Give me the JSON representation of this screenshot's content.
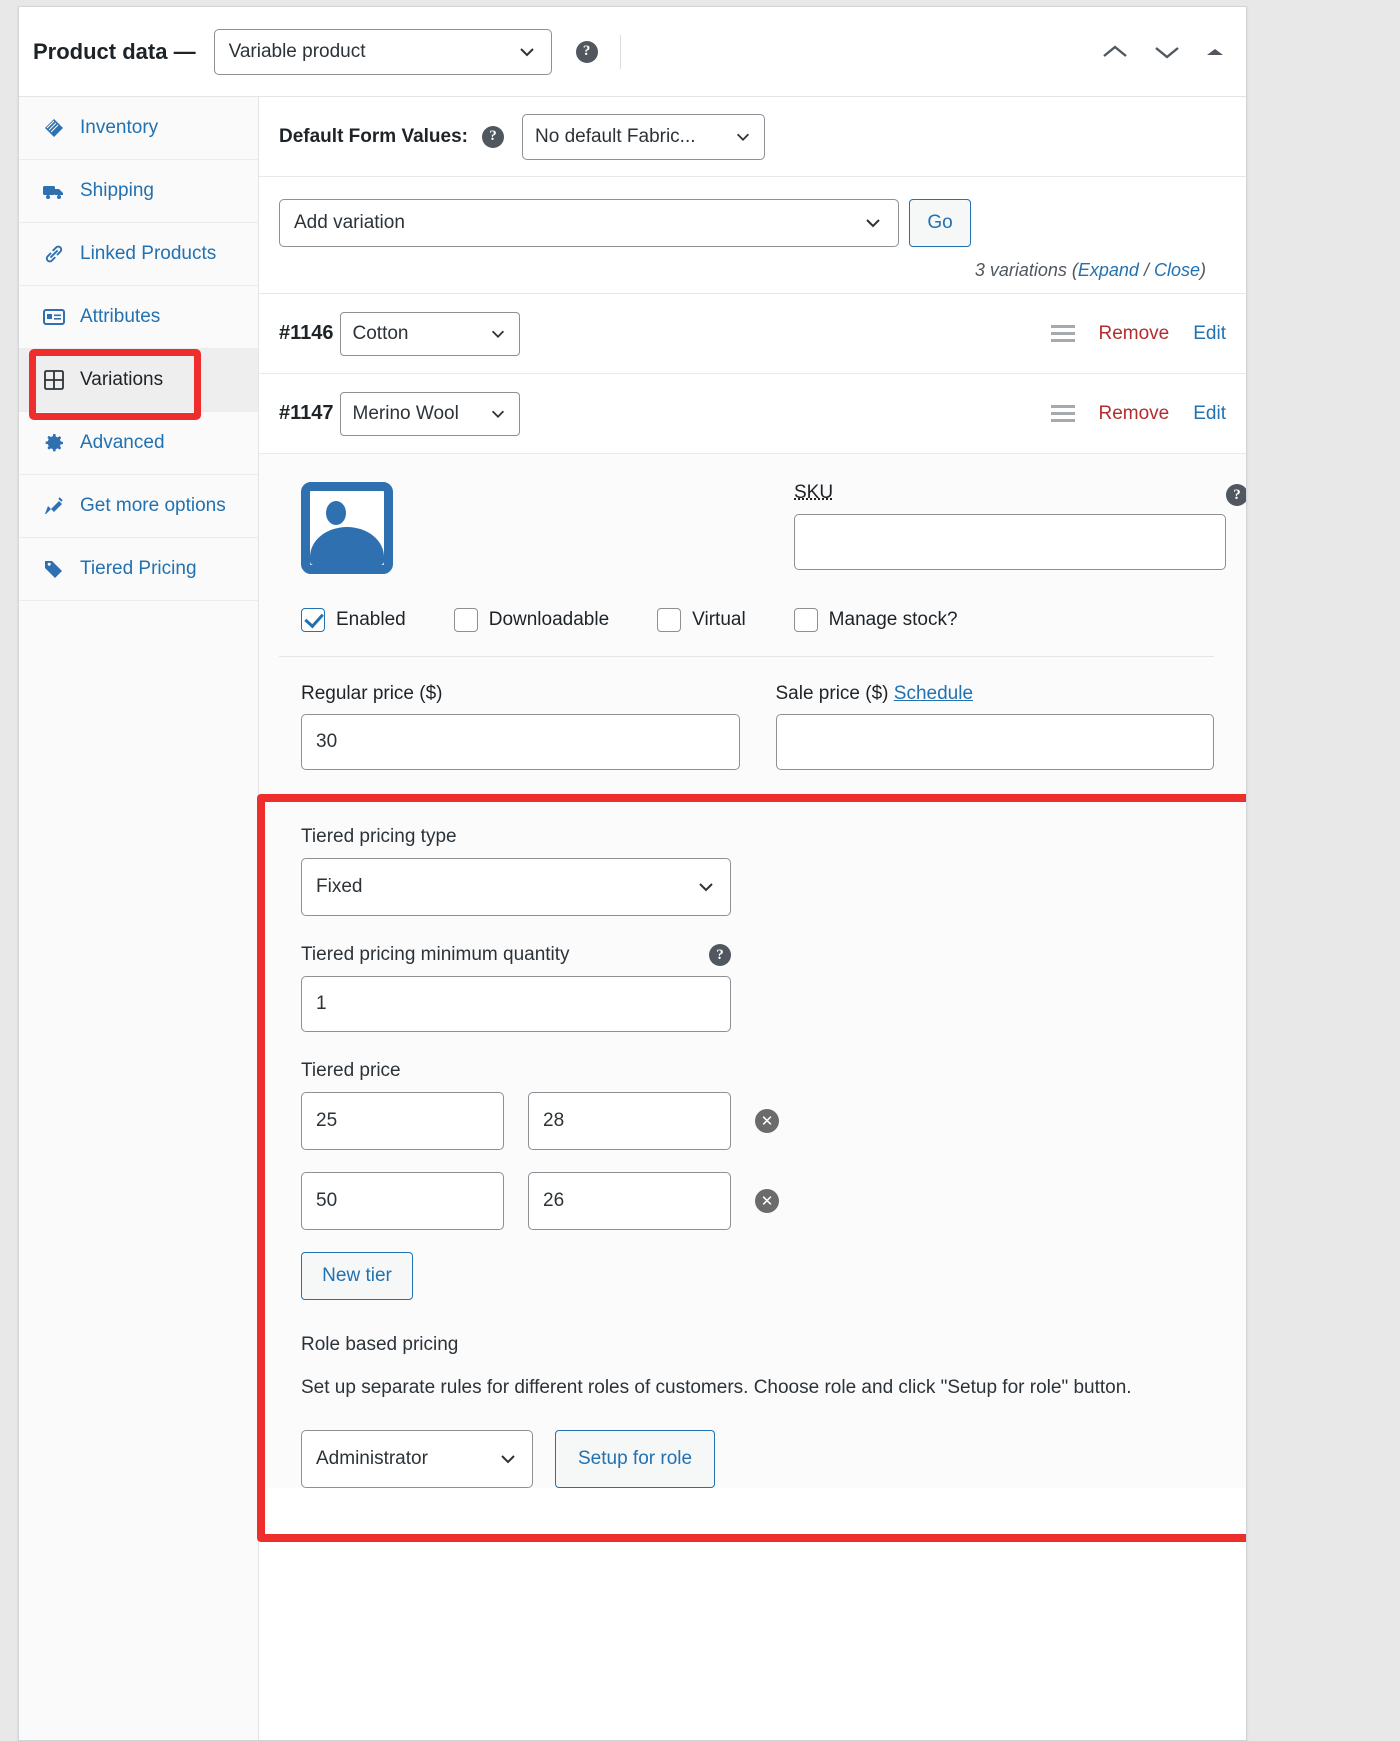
{
  "header": {
    "title": "Product data —",
    "product_type": "Variable product",
    "help_icon": "help-circle-icon",
    "collapse_up_icon": "chevron-up-icon",
    "collapse_down_icon": "chevron-down-icon",
    "toggle_icon": "caret-up-icon"
  },
  "sidebar": {
    "items": [
      {
        "label": "Inventory",
        "icon": "inventory-tag-icon",
        "active": false
      },
      {
        "label": "Shipping",
        "icon": "truck-icon",
        "active": false
      },
      {
        "label": "Linked Products",
        "icon": "link-icon",
        "active": false
      },
      {
        "label": "Attributes",
        "icon": "attributes-card-icon",
        "active": false
      },
      {
        "label": "Variations",
        "icon": "grid-icon",
        "active": true
      },
      {
        "label": "Advanced",
        "icon": "gear-icon",
        "active": false
      },
      {
        "label": "Get more options",
        "icon": "plugin-icon",
        "active": false
      },
      {
        "label": "Tiered Pricing",
        "icon": "price-tag-icon",
        "active": false
      }
    ]
  },
  "main": {
    "defaults": {
      "label": "Default Form Values:",
      "help_icon": "help-circle-icon",
      "selected": "No default Fabric...",
      "chevron_icon": "chevron-down-icon"
    },
    "toolbar": {
      "add_variation_selected": "Add variation",
      "go_label": "Go",
      "chevron_icon": "chevron-down-icon"
    },
    "variations_summary": {
      "count_text": "3 variations",
      "open_paren": "(",
      "expand_label": "Expand",
      "separator": " / ",
      "close_label": "Close",
      "close_paren": ")"
    },
    "variation_rows": [
      {
        "id": "#1146",
        "attribute": "Cotton",
        "drag_icon": "drag-handle-icon",
        "remove_label": "Remove",
        "edit_label": "Edit",
        "chevron_icon": "chevron-down-icon"
      },
      {
        "id": "#1147",
        "attribute": "Merino Wool",
        "drag_icon": "drag-handle-icon",
        "remove_label": "Remove",
        "edit_label": "Edit",
        "chevron_icon": "chevron-down-icon"
      }
    ],
    "detail": {
      "thumbnail_icon": "image-placeholder-icon",
      "sku_label": "SKU",
      "sku_value": "",
      "sku_help_icon": "help-circle-icon",
      "checkboxes": [
        {
          "label": "Enabled",
          "checked": true
        },
        {
          "label": "Downloadable",
          "checked": false
        },
        {
          "label": "Virtual",
          "checked": false
        },
        {
          "label": "Manage stock?",
          "checked": false
        }
      ],
      "regular_price_label": "Regular price ($)",
      "regular_price_value": "30",
      "sale_price_label": "Sale price ($)",
      "sale_price_schedule": "Schedule",
      "sale_price_value": ""
    },
    "tiered": {
      "type_label": "Tiered pricing type",
      "type_value": "Fixed",
      "min_qty_label": "Tiered pricing minimum quantity",
      "min_qty_help_icon": "help-circle-icon",
      "min_qty_value": "1",
      "tiered_price_label": "Tiered price",
      "tiers": [
        {
          "qty": "25",
          "price": "28",
          "delete_icon": "delete-circle-icon"
        },
        {
          "qty": "50",
          "price": "26",
          "delete_icon": "delete-circle-icon"
        }
      ],
      "new_tier_label": "New tier",
      "role_title": "Role based pricing",
      "role_description": "Set up separate rules for different roles of customers. Choose role and click \"Setup for role\" button.",
      "role_selected": "Administrator",
      "setup_for_role_label": "Setup for role",
      "chevron_icon": "chevron-down-icon"
    }
  },
  "highlights": {
    "color": "#ee2d2d",
    "targets": [
      "sidebar-item-variations",
      "tiered-pricing-section"
    ]
  }
}
